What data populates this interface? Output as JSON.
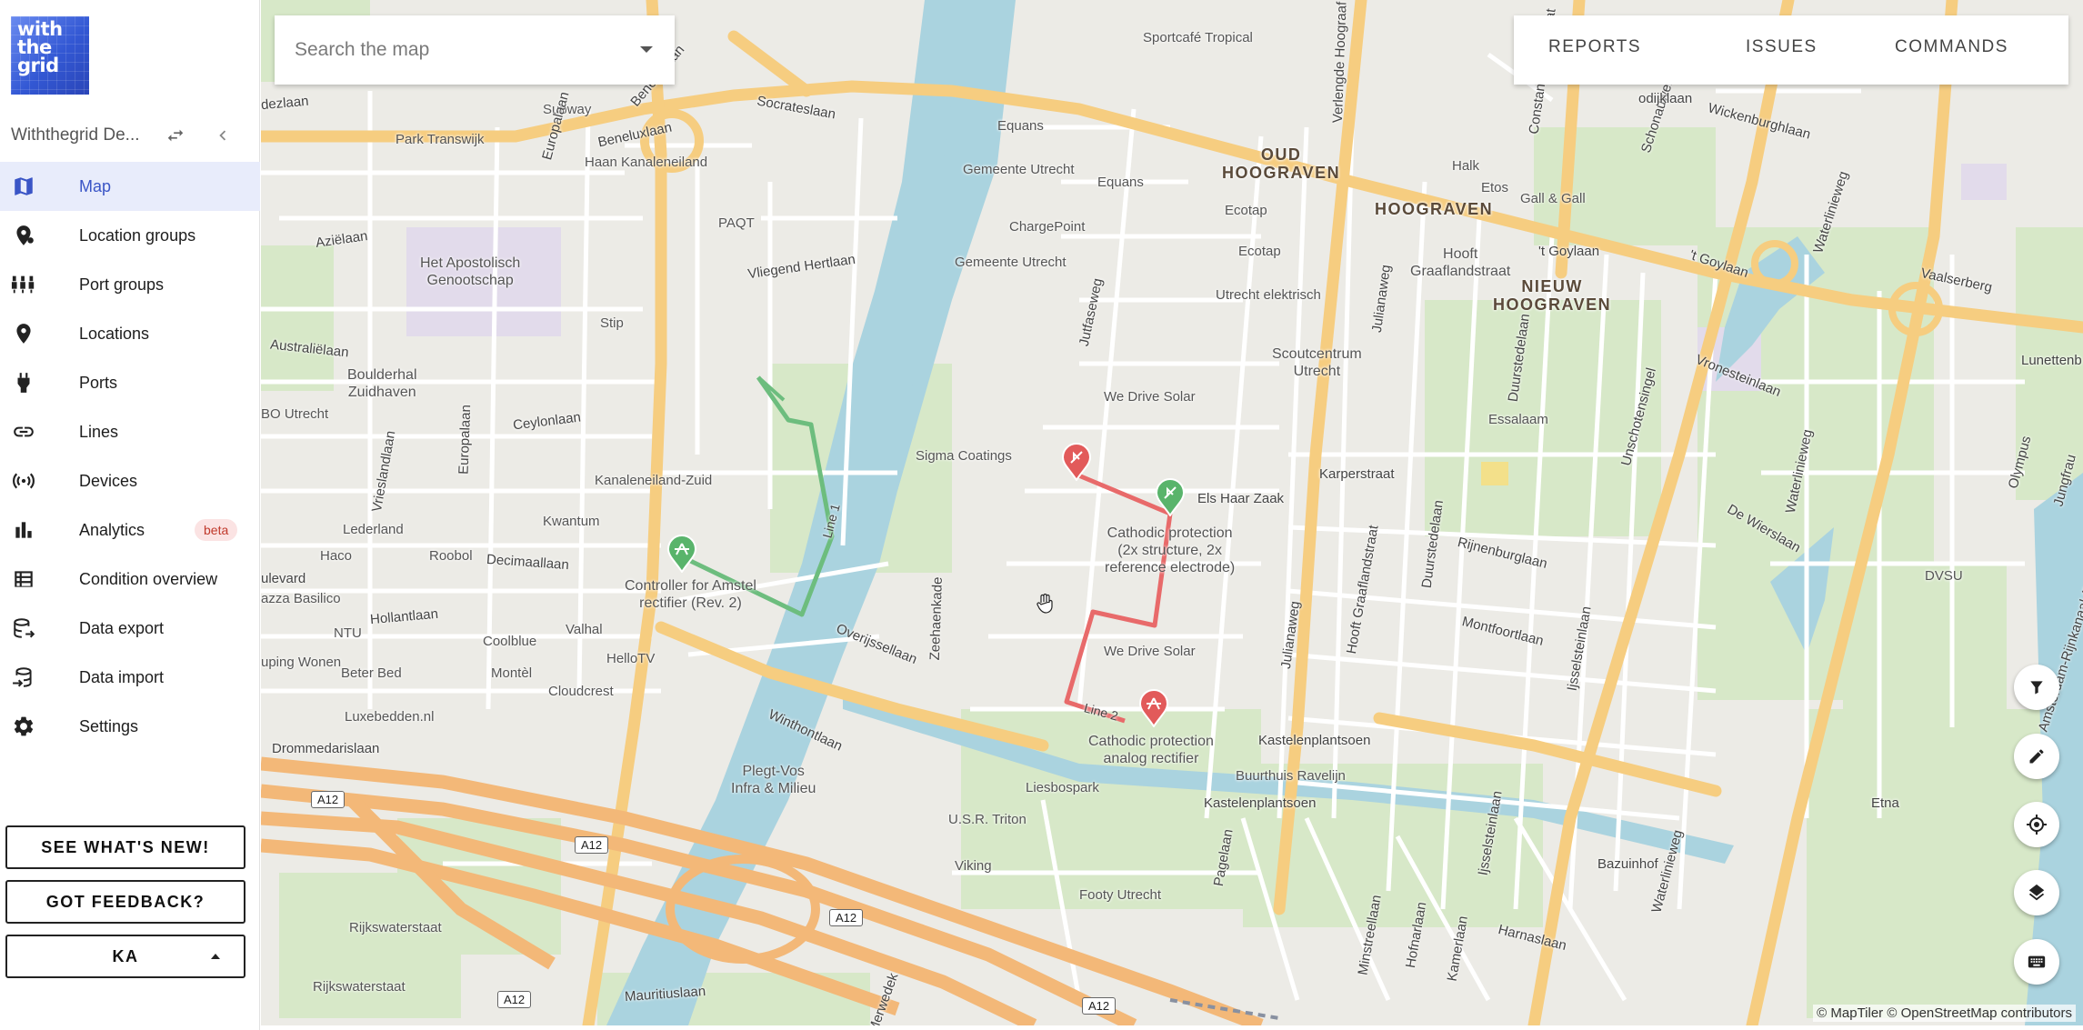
{
  "logo": {
    "text": "with\nthe\ngrid"
  },
  "org": {
    "name": "Withthegrid De..."
  },
  "nav": [
    {
      "label": "Map",
      "icon": "map-icon",
      "active": true
    },
    {
      "label": "Location groups",
      "icon": "location-groups-icon"
    },
    {
      "label": "Port groups",
      "icon": "port-groups-icon"
    },
    {
      "label": "Locations",
      "icon": "location-pin-icon"
    },
    {
      "label": "Ports",
      "icon": "port-plug-icon"
    },
    {
      "label": "Lines",
      "icon": "link-icon"
    },
    {
      "label": "Devices",
      "icon": "broadcast-icon"
    },
    {
      "label": "Analytics",
      "icon": "bar-chart-icon",
      "badge": "beta"
    },
    {
      "label": "Condition overview",
      "icon": "table-icon"
    },
    {
      "label": "Data export",
      "icon": "database-export-icon"
    },
    {
      "label": "Data import",
      "icon": "database-import-icon"
    },
    {
      "label": "Settings",
      "icon": "gear-icon"
    }
  ],
  "buttons": {
    "whats_new": "SEE WHAT'S NEW!",
    "feedback": "GOT FEEDBACK?",
    "user": "KA"
  },
  "search": {
    "placeholder": "Search the map"
  },
  "topbar": {
    "reports": "REPORTS",
    "issues": "ISSUES",
    "commands": "COMMANDS"
  },
  "map": {
    "districts": {
      "oud_hoograven": "OUD\nHOOGRAVEN",
      "hoograven": "HOOGRAVEN",
      "nieuw_hoograven": "NIEUW\nHOOGRAVEN"
    },
    "places": {
      "sportcafe": "Sportcafé Tropical",
      "subway": "Subway",
      "park_transwijk": "Park Transwijk",
      "equans1": "Equans",
      "haan": "Haan Kanaleneiland",
      "gemeente1": "Gemeente Utrecht",
      "equans2": "Equans",
      "halk": "Halk",
      "etos": "Etos",
      "gall": "Gall & Gall",
      "paqt": "PAQT",
      "chargepoint": "ChargePoint",
      "ecotap1": "Ecotap",
      "ecotap2": "Ecotap",
      "apostolisch": "Het Apostolisch\nGenootschap",
      "gemeente2": "Gemeente Utrecht",
      "utrecht_elektrisch": "Utrecht elektrisch",
      "stip": "Stip",
      "scoutcentrum": "Scoutcentrum\nUtrecht",
      "boulderhal": "Boulderhal\nZuidhaven",
      "bo_utrecht": "BO Utrecht",
      "essalaam": "Essalaam",
      "we_drive_solar1": "We Drive Solar",
      "sigma": "Sigma Coatings",
      "kanaleneiland_zuid": "Kanaleneiland-Zuid",
      "kwantum": "Kwantum",
      "lederland": "Lederland",
      "haco": "Haco",
      "roobol": "Roobol",
      "dvsu": "DVSU",
      "azza": "azza Basilico",
      "ntu": "NTU",
      "valhal": "Valhal",
      "coolblue": "Coolblue",
      "hellotv": "HelloTV",
      "aupingwonen": "uping Wonen",
      "beter_bed": "Beter Bed",
      "montel": "Montèl",
      "cloudcrest": "Cloudcrest",
      "we_drive_solar2": "We Drive Solar",
      "luxebedden": "Luxebedden.nl",
      "plegt": "Plegt-Vos\nInfra & Milieu",
      "liesbospark": "Liesbospark",
      "usr_triton": "U.S.R. Triton",
      "viking": "Viking",
      "footy": "Footy Utrecht",
      "buurthuis": "Buurthuis Ravelijn",
      "rijkswaterstaat1": "Rijkswaterstaat",
      "rijkswaterstaat2": "Rijkswaterstaat"
    },
    "roads": {
      "socrateslaan": "Socrateslaan",
      "beneluxlaan": "Beneluxlaan",
      "europalaan1": "Europalaan",
      "europalaan2": "Europalaan",
      "aziëlaan": "Aziëlaan",
      "australiëlaan": "Australiëlaan",
      "vliegend_hertlaan": "Vliegend Hertlaan",
      "ceylonlaan": "Ceylonlaan",
      "vrieslandlaan": "Vrieslandlaan",
      "decimaallaan": "Decimaallaan",
      "hollantlaan": "Hollantlaan",
      "overijssellaan": "Overijssellaan",
      "winthontlaan": "Winthontlaan",
      "drommedarislaan": "Drommedarislaan",
      "zeehaenkade": "Zeehaenkade",
      "jutfaseweg": "Jutfaseweg",
      "verlengde_hoograaf": "Verlengde Hoograaf",
      "constant_erzeijstraat": "Constant Erzeijstraat",
      "julianaweg1": "Julianaweg",
      "julianaweg2": "Julianaweg",
      "hooft_graaflandstraat1": "Hooft\nGraaflandstraat",
      "hooft_graaflandstraat2": "Hooft Graaflandstraat",
      "t_goylaan1": "'t Goylaan",
      "t_goylaan2": "'t Goylaan",
      "duurstedelaan1": "Duurstedelaan",
      "duurstedelaan2": "Duurstedelaan",
      "karperstraat": "Karperstraat",
      "els_haar_zaak": "Els Haar Zaak",
      "rijnenburglaan": "Rijnenburglaan",
      "montfoortlaan": "Montfoortlaan",
      "vronesteinlaan": "Vronesteinlaan",
      "de_wierslaan": "De Wierslaan",
      "unschotensingel": "Unschotensingel",
      "schonauwenstraat": "Schonauwenstraat",
      "wickenburghlaan": "Wickenburghlaan",
      "waterlinieweg1": "Waterlinieweg",
      "waterlinieweg2": "Waterlinieweg",
      "waterlinieweg3": "Waterlinieweg",
      "vaalserberg": "Vaalserberg",
      "lunettenb": "Lunettenb",
      "olympus": "Olympus",
      "jungfrau": "Jungfrau",
      "etna": "Etna",
      "ijsselsteinlaan1": "Ijsselsteinlaan",
      "ijsselsteinlaan2": "Ijsselsteinlaan",
      "kastelenplantsoen1": "Kastelenplantsoen",
      "kastelenplantsoen2": "Kastelenplantsoen",
      "bazuinhof": "Bazuinhof",
      "harnaslaan": "Harnaslaan",
      "pagelaan": "Pagelaan",
      "minstreellaan": "Minstreellaan",
      "hofnarlaan": "Hofnarlaan",
      "kamerlaan": "Kamerlaan",
      "mauritiuslaan": "Mauritiuslaan",
      "ulevard": "ulevard",
      "dezlaan": "dezlaan",
      "odijklaan": "odijklaan",
      "merwede": "Merwedek",
      "amsterdam_rijnkanaal": "Amsterdam-Rijnkanaal (NHW)"
    },
    "highway": "A12",
    "annotations": {
      "controller": "Controller for Amstel\nrectifier (Rev. 2)",
      "cathodic1": "Cathodic protection\n(2x structure, 2x\nreference electrode)",
      "cathodic2": "Cathodic protection\nanalog rectifier",
      "line1": "Line 1",
      "line2": "Line 2"
    },
    "colors": {
      "line_green": "#6dbd7e",
      "line_red": "#e86a6a",
      "marker_red": "#e25a5a",
      "marker_green": "#59b46b",
      "water": "#aad3df",
      "major_road": "#f6cd80"
    }
  },
  "fabs": [
    "filter-icon",
    "pencil-icon",
    "crosshair-icon",
    "layers-icon",
    "keyboard-icon"
  ],
  "attribution": "© MapTiler © OpenStreetMap contributors"
}
